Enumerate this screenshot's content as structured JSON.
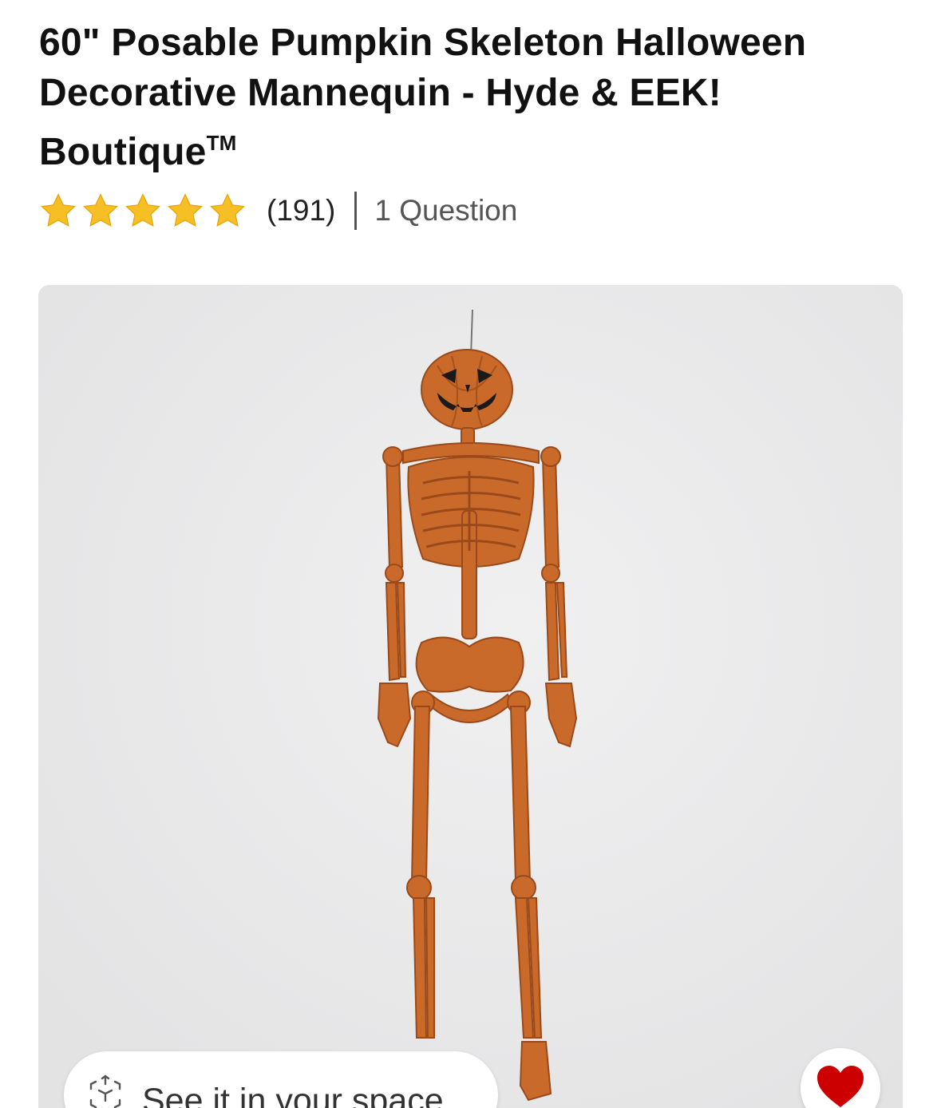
{
  "product": {
    "title_main": "60\" Posable Pumpkin Skeleton Halloween Decorative Mannequin - Hyde & EEK! Boutique",
    "title_tm": "TM",
    "rating": {
      "stars": 5,
      "review_count_label": "(191)",
      "questions_label": "1 Question"
    }
  },
  "image": {
    "description_icon": "pumpkin-skeleton-image"
  },
  "actions": {
    "ar_label": "See it in your space",
    "ar_icon": "ar-cube-icon",
    "favorite_icon": "heart-icon"
  },
  "colors": {
    "star": "#f6bf26",
    "heart": "#cc0000",
    "skeleton": "#c9692a",
    "text": "#111111"
  }
}
